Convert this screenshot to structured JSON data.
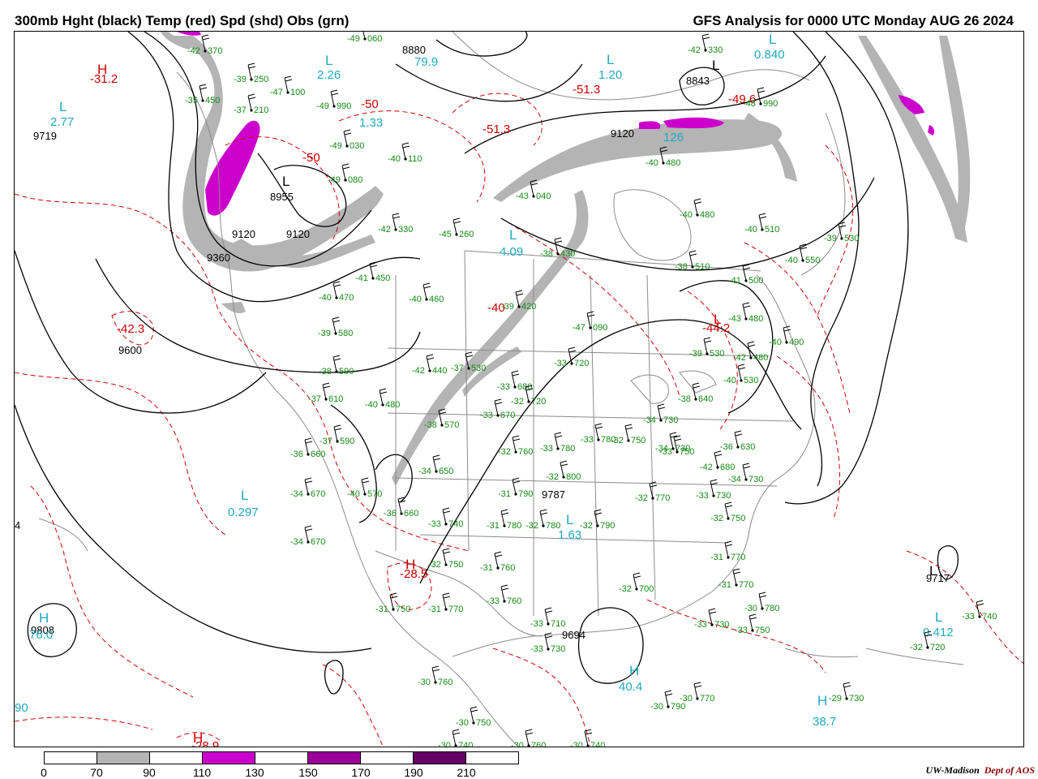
{
  "header": {
    "title_left": "300mb Hght (black) Temp (red) Spd (shd) Obs (grn)",
    "title_right": "GFS Analysis for 0000 UTC Monday  AUG 26 2024"
  },
  "colors": {
    "height": "#000000",
    "temperature": "#cc0000",
    "speed_label": "#20a8c0",
    "observation": "#138a13",
    "shade_70_90": "#b4b4b4",
    "shade_110_130": "#cc00cc",
    "shade_150_170": "#990099",
    "shade_190_210": "#660066",
    "geography": "#8c8c8c"
  },
  "colorbar": {
    "labels": [
      "0",
      "70",
      "90",
      "110",
      "130",
      "150",
      "170",
      "190",
      "210"
    ],
    "segments": [
      "#ffffff",
      "#b4b4b4",
      "#ffffff",
      "#cc00cc",
      "#ffffff",
      "#990099",
      "#ffffff",
      "#660066",
      "#ffffff"
    ]
  },
  "height_labels": [
    "9719",
    "8955",
    "9120",
    "9120",
    "9360",
    "9600",
    "9120",
    "8880",
    "8843",
    "9717",
    "9808",
    "9694",
    "9787",
    "4"
  ],
  "temperature_labels": [
    "-31.2",
    "-50",
    "-51.3",
    "-51.3",
    "-49.6",
    "-44.2",
    "-42.3",
    "-28.5",
    "-28.9",
    "-40",
    "-50"
  ],
  "speed_labels": [
    "2.77",
    "2.26",
    "1.33",
    "1.20",
    "0.840",
    "4.09",
    "0.297",
    "1.63",
    "40.4",
    "38.7",
    "0.412",
    "76.0",
    "79.9",
    "126",
    "90"
  ],
  "station_obs": [
    [
      "-42",
      "370"
    ],
    [
      "-35",
      "450"
    ],
    [
      "-37",
      "210"
    ],
    [
      "-39",
      "250"
    ],
    [
      "-47",
      "100"
    ],
    [
      "-49",
      "060"
    ],
    [
      "-49",
      "990"
    ],
    [
      "-49",
      "030"
    ],
    [
      "-49",
      "080"
    ],
    [
      "-40",
      "110"
    ],
    [
      "-42",
      "330"
    ],
    [
      "-45",
      "260"
    ],
    [
      "-43",
      "040"
    ],
    [
      "-38",
      "430"
    ],
    [
      "-41",
      "450"
    ],
    [
      "-40",
      "470"
    ],
    [
      "-40",
      "460"
    ],
    [
      "-39",
      "420"
    ],
    [
      "-39",
      "580"
    ],
    [
      "-38",
      "590"
    ],
    [
      "-37",
      "610"
    ],
    [
      "-40",
      "480"
    ],
    [
      "-42",
      "440"
    ],
    [
      "-37",
      "530"
    ],
    [
      "-33",
      "680"
    ],
    [
      "-33",
      "720"
    ],
    [
      "-32",
      "720"
    ],
    [
      "-33",
      "670"
    ],
    [
      "-38",
      "570"
    ],
    [
      "-37",
      "590"
    ],
    [
      "-36",
      "660"
    ],
    [
      "-34",
      "670"
    ],
    [
      "-40",
      "570"
    ],
    [
      "-36",
      "660"
    ],
    [
      "-34",
      "650"
    ],
    [
      "-32",
      "760"
    ],
    [
      "-33",
      "780"
    ],
    [
      "-32",
      "800"
    ],
    [
      "-33",
      "780"
    ],
    [
      "-31",
      "790"
    ],
    [
      "-33",
      "740"
    ],
    [
      "-31",
      "780"
    ],
    [
      "-32",
      "780"
    ],
    [
      "-32",
      "790"
    ],
    [
      "-32",
      "770"
    ],
    [
      "-33",
      "750"
    ],
    [
      "-34",
      "670"
    ],
    [
      "-32",
      "750"
    ],
    [
      "-31",
      "760"
    ],
    [
      "-32",
      "750"
    ],
    [
      "-31",
      "750"
    ],
    [
      "-31",
      "770"
    ],
    [
      "-33",
      "760"
    ],
    [
      "-32",
      "700"
    ],
    [
      "-33",
      "710"
    ],
    [
      "-33",
      "730"
    ],
    [
      "-30",
      "760"
    ],
    [
      "-30",
      "750"
    ],
    [
      "-30",
      "740"
    ],
    [
      "-30",
      "760"
    ],
    [
      "-30",
      "740"
    ],
    [
      "-30",
      "790"
    ],
    [
      "-30",
      "770"
    ],
    [
      "-29",
      "730"
    ],
    [
      "-32",
      "720"
    ],
    [
      "-33",
      "740"
    ],
    [
      "-30",
      "780"
    ],
    [
      "-31",
      "770"
    ],
    [
      "-31",
      "770"
    ],
    [
      "-32",
      "750"
    ],
    [
      "-34",
      "730"
    ],
    [
      "-34",
      "730"
    ],
    [
      "-36",
      "630"
    ],
    [
      "-38",
      "640"
    ],
    [
      "-40",
      "480"
    ],
    [
      "-40",
      "510"
    ],
    [
      "-39",
      "530"
    ],
    [
      "-40",
      "550"
    ],
    [
      "-41",
      "500"
    ],
    [
      "-43",
      "480"
    ],
    [
      "-40",
      "490"
    ],
    [
      "-42",
      "480"
    ],
    [
      "-39",
      "530"
    ],
    [
      "-40",
      "530"
    ],
    [
      "-38",
      "510"
    ],
    [
      "-40",
      "480"
    ],
    [
      "-42",
      "330"
    ],
    [
      "-48",
      "990"
    ],
    [
      "-47",
      "090"
    ],
    [
      "-42",
      "680"
    ],
    [
      "-33",
      "730"
    ],
    [
      "-34",
      "730"
    ],
    [
      "-33",
      "730"
    ],
    [
      "-33",
      "750"
    ],
    [
      "-30",
      "780"
    ]
  ],
  "footer": {
    "credit_org": "UW-Madison",
    "credit_dept": "Dept of AOS"
  }
}
